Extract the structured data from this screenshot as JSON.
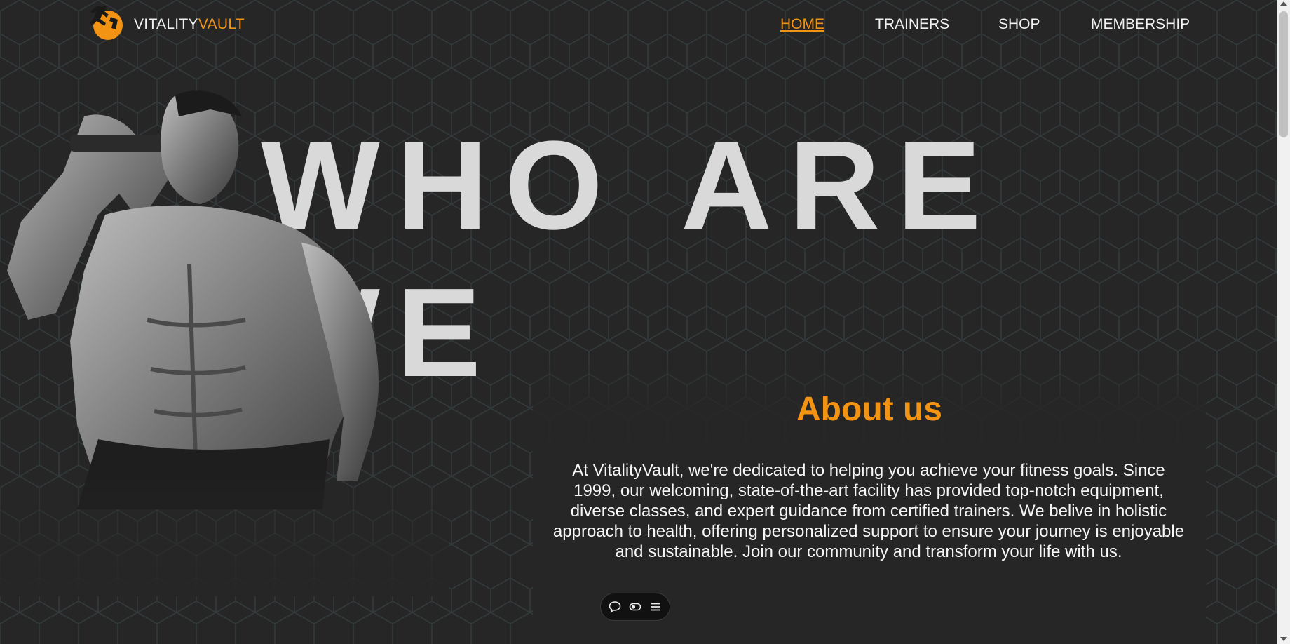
{
  "brand": {
    "name_part1": "VITALITY",
    "name_part2": "VAULT",
    "accent_color": "#f39313"
  },
  "nav": {
    "items": [
      "HOME",
      "TRAINERS",
      "SHOP",
      "MEMBERSHIP"
    ],
    "active": "HOME"
  },
  "hero": {
    "title": "WHO ARE WE"
  },
  "about": {
    "title": "About us",
    "body": "At VitalityVault, we're dedicated to helping you achieve your fitness goals. Since 1999, our welcoming, state-of-the-art facility has provided top-notch equipment, diverse classes, and expert guidance from certified trainers. We belive in holistic approach to health, offering personalized support to ensure your journey is enjoyable and sustainable. Join our community and transform your life with us."
  },
  "toolbar": {
    "icons": [
      "chat-icon",
      "toggle-icon",
      "menu-icon"
    ]
  },
  "colors": {
    "background": "#262626",
    "accent": "#f39313",
    "text": "#f2f2f2"
  }
}
